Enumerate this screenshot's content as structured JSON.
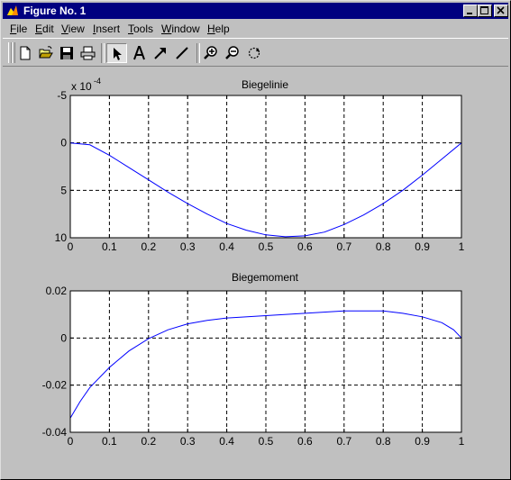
{
  "window": {
    "title": "Figure No. 1"
  },
  "menu": [
    {
      "mnemonic": "F",
      "rest": "ile"
    },
    {
      "mnemonic": "E",
      "rest": "dit"
    },
    {
      "mnemonic": "V",
      "rest": "iew"
    },
    {
      "mnemonic": "I",
      "rest": "nsert"
    },
    {
      "mnemonic": "T",
      "rest": "ools"
    },
    {
      "mnemonic": "W",
      "rest": "indow"
    },
    {
      "mnemonic": "H",
      "rest": "elp"
    }
  ],
  "toolbar": {
    "buttons": [
      "new-figure-icon",
      "open-file-icon",
      "save-icon",
      "print-icon",
      "select-arrow-icon",
      "text-icon",
      "arrow-icon",
      "line-icon",
      "zoom-in-icon",
      "zoom-out-icon",
      "rotate-icon"
    ],
    "pressed": "select-arrow-icon"
  },
  "chart_data": [
    {
      "type": "line",
      "title": "Biegelinie",
      "xlabel": "",
      "ylabel": "",
      "y_exponent_label": "x 10",
      "y_exponent": "-4",
      "xlim": [
        0,
        1
      ],
      "ylim": [
        -5,
        10
      ],
      "y_reversed": true,
      "grid": true,
      "x_ticks": [
        "0",
        "0.1",
        "0.2",
        "0.3",
        "0.4",
        "0.5",
        "0.6",
        "0.7",
        "0.8",
        "0.9",
        "1"
      ],
      "y_ticks": [
        "-5",
        "0",
        "5",
        "10"
      ],
      "series": [
        {
          "color": "#0000ff",
          "x": [
            0,
            0.05,
            0.1,
            0.15,
            0.2,
            0.25,
            0.3,
            0.35,
            0.4,
            0.45,
            0.5,
            0.55,
            0.6,
            0.65,
            0.7,
            0.75,
            0.8,
            0.85,
            0.9,
            0.95,
            1
          ],
          "y": [
            0,
            0.2,
            1.3,
            2.6,
            3.9,
            5.2,
            6.4,
            7.5,
            8.5,
            9.2,
            9.7,
            9.9,
            9.8,
            9.4,
            8.6,
            7.6,
            6.4,
            5.0,
            3.4,
            1.7,
            0
          ]
        }
      ]
    },
    {
      "type": "line",
      "title": "Biegemoment",
      "xlabel": "",
      "ylabel": "",
      "xlim": [
        0,
        1
      ],
      "ylim": [
        -0.04,
        0.02
      ],
      "grid": true,
      "x_ticks": [
        "0",
        "0.1",
        "0.2",
        "0.3",
        "0.4",
        "0.5",
        "0.6",
        "0.7",
        "0.8",
        "0.9",
        "1"
      ],
      "y_ticks": [
        "0.02",
        "0",
        "-0.02",
        "-0.04"
      ],
      "series": [
        {
          "color": "#0000ff",
          "x": [
            0,
            0.025,
            0.05,
            0.1,
            0.15,
            0.2,
            0.25,
            0.3,
            0.35,
            0.4,
            0.5,
            0.6,
            0.7,
            0.8,
            0.85,
            0.9,
            0.95,
            0.98,
            1
          ],
          "y": [
            -0.034,
            -0.027,
            -0.021,
            -0.0125,
            -0.0055,
            -0.0003,
            0.0035,
            0.006,
            0.0075,
            0.0085,
            0.0095,
            0.0105,
            0.0115,
            0.0115,
            0.0105,
            0.009,
            0.0065,
            0.0035,
            0
          ]
        }
      ]
    }
  ]
}
